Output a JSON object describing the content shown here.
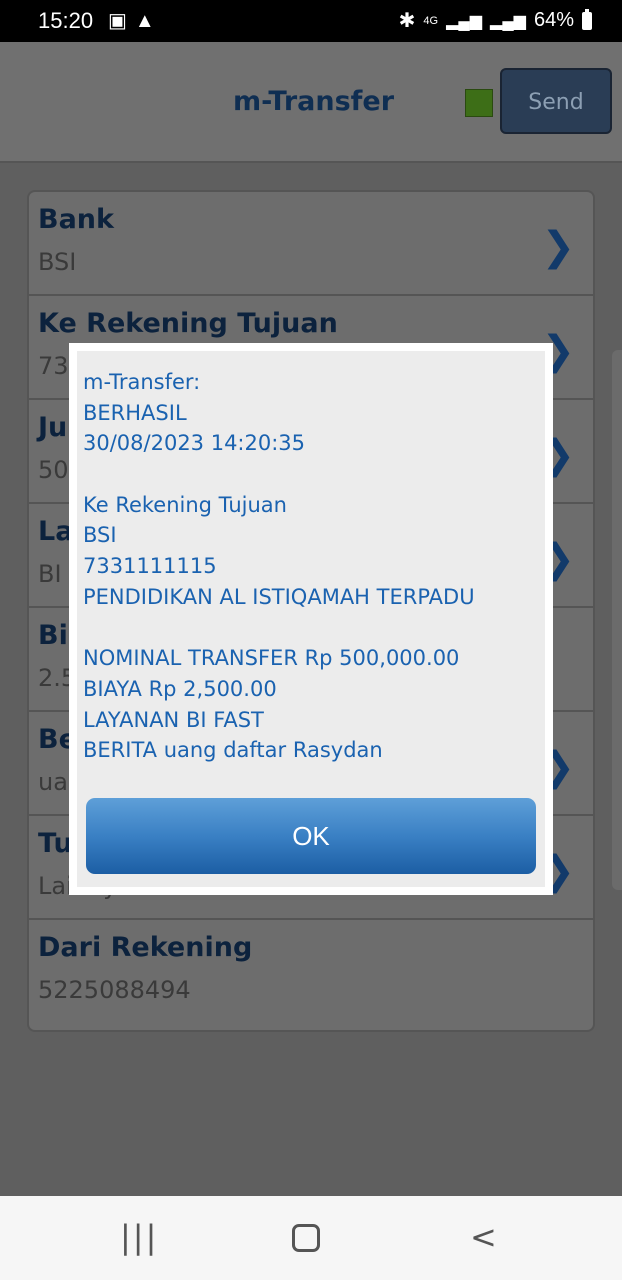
{
  "status_bar": {
    "time": "15:20",
    "left_icons": [
      "notification-icon",
      "warning-icon"
    ],
    "right_icons": [
      "bluetooth-icon",
      "4g-icon",
      "signal-icon",
      "signal-icon"
    ],
    "network": "4G",
    "battery": "64%"
  },
  "header": {
    "title": "m-Transfer",
    "send_label": "Send",
    "indicator_color": "#3d6e17"
  },
  "form": {
    "rows": [
      {
        "label": "Bank",
        "value": "BSI"
      },
      {
        "label": "Ke Rekening Tujuan",
        "value": "73"
      },
      {
        "label": "Ju",
        "value": "50"
      },
      {
        "label": "La",
        "value": "BI"
      },
      {
        "label": "Bi",
        "value": "2.5"
      },
      {
        "label": "Be",
        "value": "ua"
      },
      {
        "label": "Tu",
        "value": "Lainnya"
      },
      {
        "label": "Dari Rekening",
        "value": "5225088494"
      }
    ]
  },
  "dialog": {
    "lines": [
      "m-Transfer:",
      "BERHASIL",
      "30/08/2023 14:20:35",
      "",
      "Ke Rekening Tujuan",
      "BSI",
      "7331111115",
      "PENDIDIKAN AL ISTIQAMAH TERPADU",
      "",
      "NOMINAL TRANSFER Rp 500,000.00",
      "BIAYA Rp 2,500.00",
      "LAYANAN BI FAST",
      "BERITA uang daftar Rasydan"
    ],
    "ok_label": "OK"
  },
  "nav_bar": {
    "recent_icon": "recent-apps-icon",
    "home_icon": "home-icon",
    "back_icon": "back-icon"
  }
}
